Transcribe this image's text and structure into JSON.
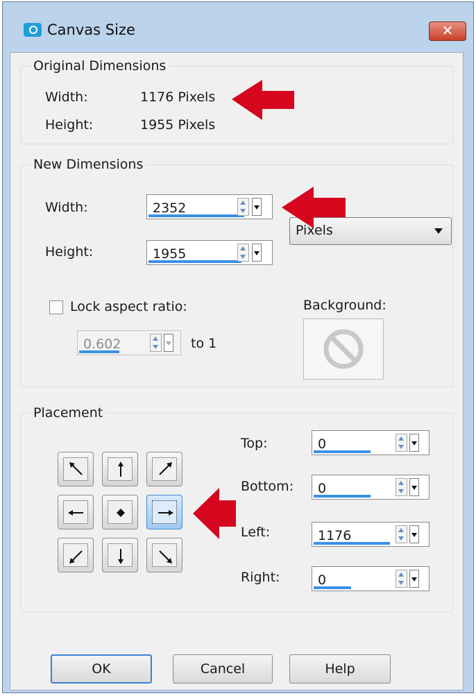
{
  "window": {
    "title": "Canvas Size",
    "close_label": "✕"
  },
  "original": {
    "legend": "Original Dimensions",
    "width_label": "Width:",
    "width_value": "1176 Pixels",
    "height_label": "Height:",
    "height_value": "1955 Pixels"
  },
  "new_dims": {
    "legend": "New Dimensions",
    "width_label": "Width:",
    "width_value": "2352",
    "height_label": "Height:",
    "height_value": "1955",
    "units": "Pixels",
    "lock_label": "Lock aspect ratio:",
    "lock_checked": false,
    "ratio_value": "0.602",
    "ratio_suffix": "to 1",
    "background_label": "Background:"
  },
  "placement": {
    "legend": "Placement",
    "selected": "right",
    "top_label": "Top:",
    "top_value": "0",
    "bottom_label": "Bottom:",
    "bottom_value": "0",
    "left_label": "Left:",
    "left_value": "1176",
    "right_label": "Right:",
    "right_value": "0"
  },
  "buttons": {
    "ok": "OK",
    "cancel": "Cancel",
    "help": "Help"
  },
  "colors": {
    "accent": "#3b8fe4",
    "annotation_arrow": "#d6061f",
    "title_bar": "#bcd3ec"
  }
}
